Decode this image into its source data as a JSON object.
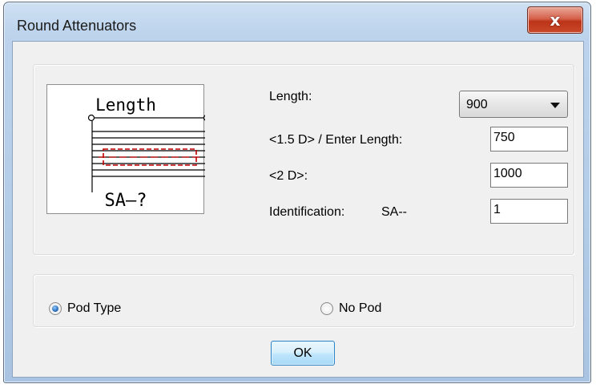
{
  "window": {
    "title": "Round Attenuators",
    "close_label": "x"
  },
  "diagram": {
    "top_label": "Length",
    "bottom_label": "SA–?"
  },
  "form": {
    "length_label": "Length:",
    "length_value": "900",
    "d15_label": "<1.5 D> / Enter Length:",
    "d15_value": "750",
    "d2_label": "<2 D>:",
    "d2_value": "1000",
    "id_label": "Identification:",
    "id_prefix": "SA--",
    "id_value": "1"
  },
  "options": {
    "pod_type_label": "Pod Type",
    "pod_type_selected": true,
    "no_pod_label": "No Pod",
    "no_pod_selected": false
  },
  "buttons": {
    "ok_label": "OK"
  },
  "colors": {
    "accent": "#2b6fbd",
    "diagram_dash": "#c00000"
  }
}
